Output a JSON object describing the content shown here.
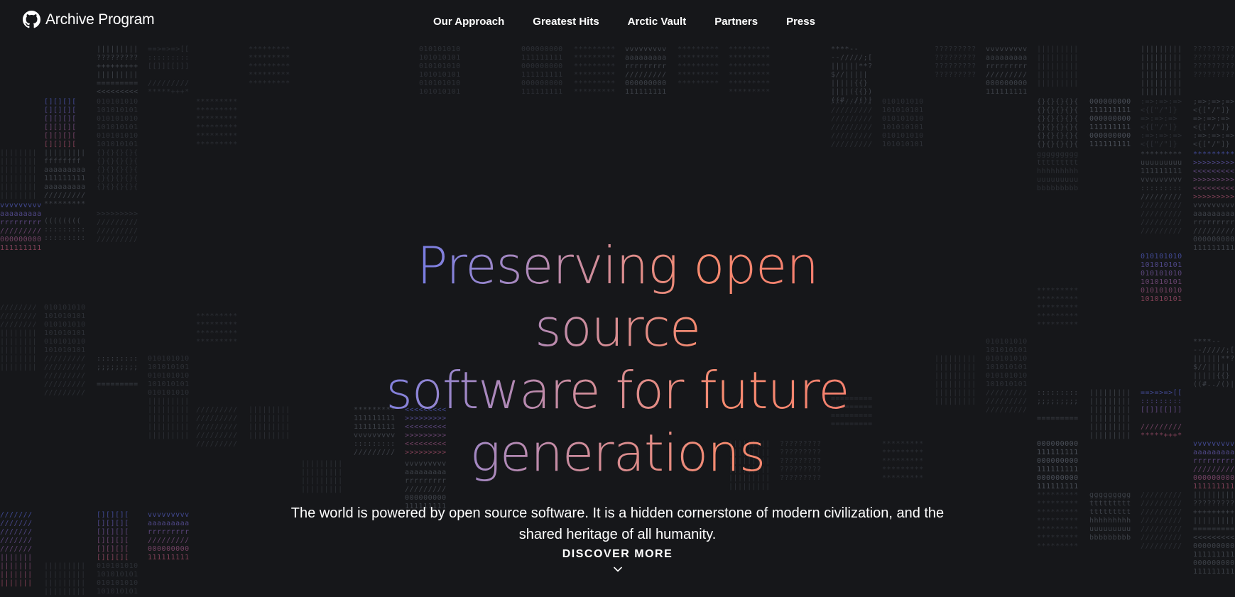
{
  "header": {
    "logo_text": "Archive Program",
    "logo_icon": "github-octocat-icon",
    "nav": [
      {
        "label": "Our Approach"
      },
      {
        "label": "Greatest Hits"
      },
      {
        "label": "Arctic Vault"
      },
      {
        "label": "Partners"
      },
      {
        "label": "Press"
      }
    ]
  },
  "hero": {
    "headline_line1": "Preserving open source",
    "headline_line2": "software for future generations",
    "subtitle": "The world is powered by open source software. It is a hidden cornerstone of modern civilization, and the shared heritage of all humanity."
  },
  "cta": {
    "label": "DISCOVER MORE",
    "icon": "chevron-down-icon"
  },
  "colors": {
    "background": "#16171a",
    "gradient_start": "#5b70f2",
    "gradient_end": "#f4776e",
    "text": "#ffffff"
  }
}
